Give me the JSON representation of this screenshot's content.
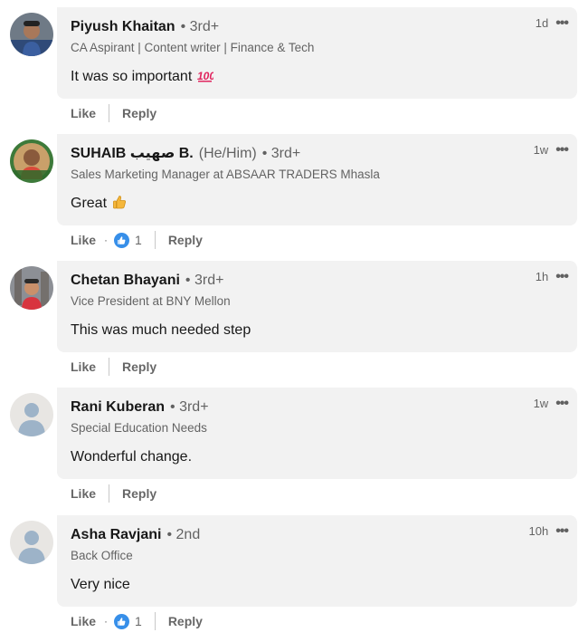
{
  "colors": {
    "bubble_bg": "#f2f2f2",
    "secondary_text": "#666666",
    "like_reaction_blue": "#378fe9",
    "ghost_avatar_bg": "#e8e6e3",
    "ghost_avatar_fg": "#9db3c8"
  },
  "comments": [
    {
      "name": "Piyush Khaitan",
      "pronouns": "",
      "degree": "• 3rd+",
      "headline": "CA Aspirant | Content writer | Finance & Tech",
      "text": "It was so important",
      "emoji_icon": "hundred-points-icon",
      "time": "1d",
      "like_label": "Like",
      "reply_label": "Reply",
      "reaction_count": "",
      "avatar": "photo"
    },
    {
      "name": "SUHAIB صهيب B.",
      "pronouns": "(He/Him)",
      "degree": "• 3rd+",
      "headline": "Sales Marketing Manager at ABSAAR TRADERS Mhasla",
      "text": "Great",
      "emoji_icon": "thumbs-up-icon",
      "time": "1w",
      "like_label": "Like",
      "reply_label": "Reply",
      "reaction_dot": "·",
      "reaction_count": "1",
      "avatar": "photo"
    },
    {
      "name": "Chetan Bhayani",
      "pronouns": "",
      "degree": "• 3rd+",
      "headline": "Vice President at BNY Mellon",
      "text": "This was much needed step",
      "emoji_icon": "",
      "time": "1h",
      "like_label": "Like",
      "reply_label": "Reply",
      "reaction_count": "",
      "avatar": "photo"
    },
    {
      "name": "Rani Kuberan",
      "pronouns": "",
      "degree": "• 3rd+",
      "headline": "Special Education Needs",
      "text": "Wonderful change.",
      "emoji_icon": "",
      "time": "1w",
      "like_label": "Like",
      "reply_label": "Reply",
      "reaction_count": "",
      "avatar": "ghost"
    },
    {
      "name": "Asha Ravjani",
      "pronouns": "",
      "degree": "• 2nd",
      "headline": "Back Office",
      "text": "Very nice",
      "emoji_icon": "",
      "time": "10h",
      "like_label": "Like",
      "reply_label": "Reply",
      "reaction_dot": "·",
      "reaction_count": "1",
      "avatar": "ghost"
    }
  ]
}
